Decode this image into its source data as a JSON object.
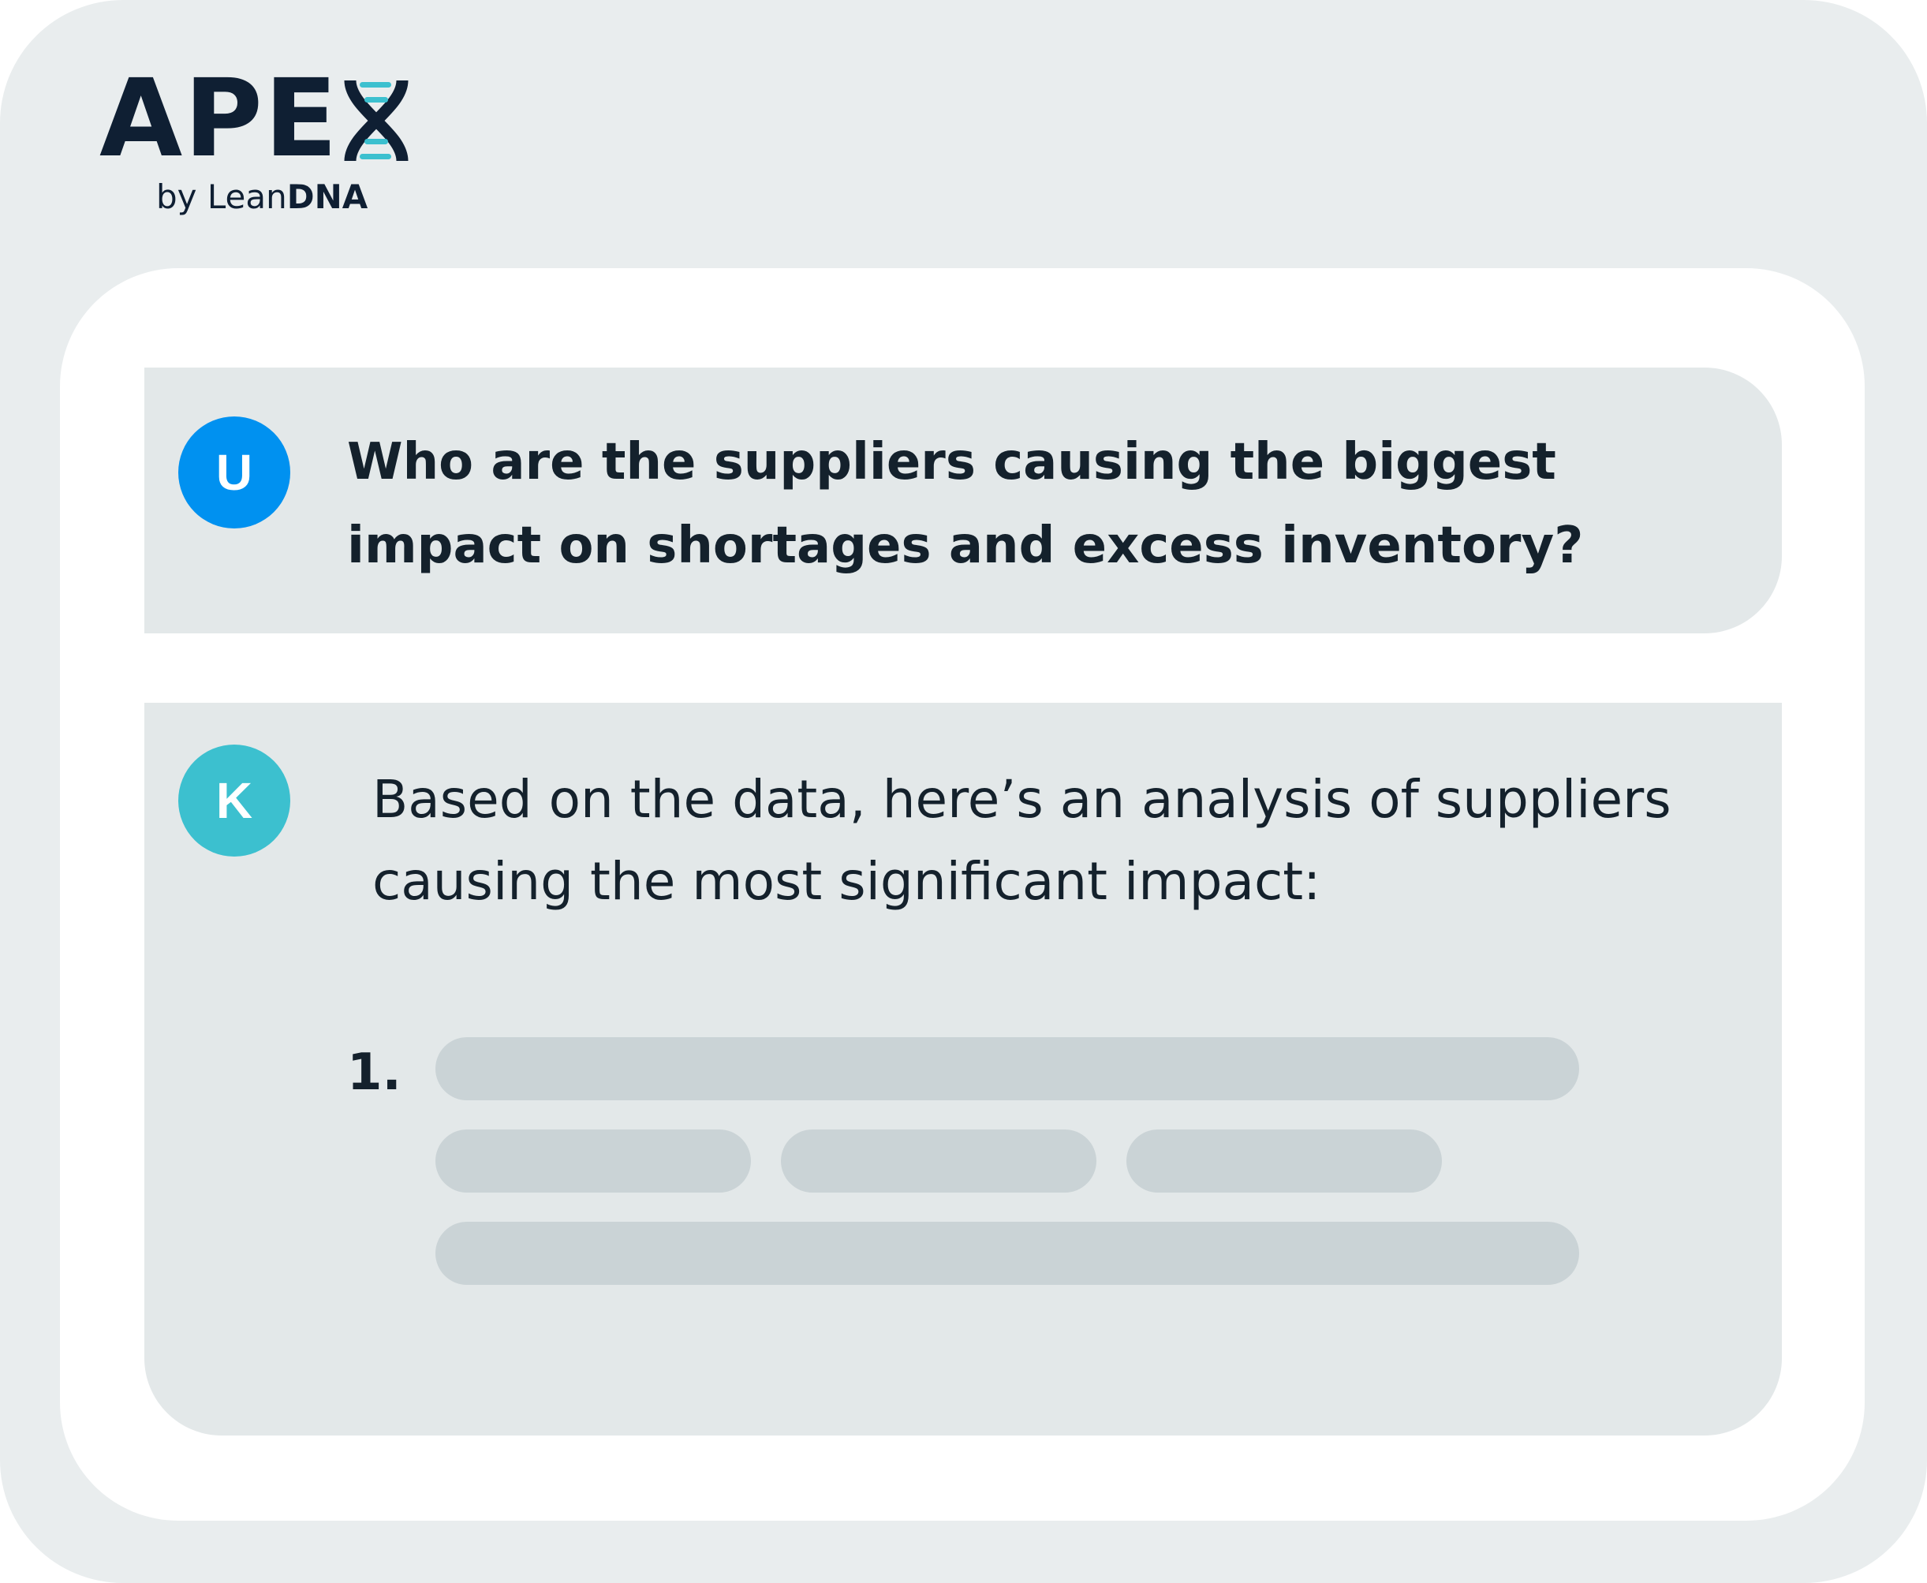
{
  "brand": {
    "logo_word": "APE",
    "logo_mark_icon": "dna-helix-x-icon",
    "byline_prefix": "by Lean",
    "byline_strong": "DNA",
    "colors": {
      "navy": "#0f1f33",
      "teal": "#3cc0cf"
    }
  },
  "chat": {
    "user": {
      "avatar_letter": "U",
      "avatar_color": "#0091f0",
      "message": "Who are the suppliers causing the biggest impact on shortages and excess inventory?"
    },
    "assistant": {
      "avatar_letter": "K",
      "avatar_color": "#3cc0cf",
      "message": "Based on the data, here’s an analysis of suppliers causing the most significant impact:",
      "list": {
        "item_number": "1.",
        "placeholder_state": "loading"
      }
    }
  },
  "colors": {
    "frame_bg": "#e9edee",
    "panel_bg": "#ffffff",
    "bubble_bg": "#e3e8e9",
    "skeleton_bar": "#cad3d6",
    "text": "#14212c"
  }
}
